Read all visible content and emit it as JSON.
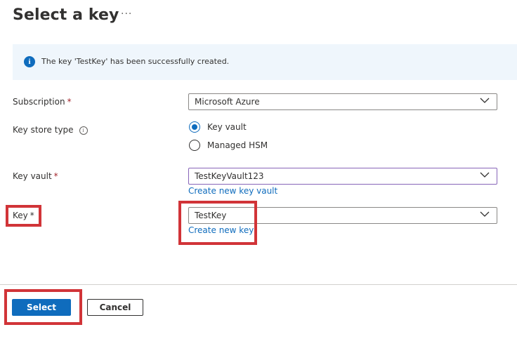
{
  "header": {
    "title": "Select a key",
    "more_label": "···"
  },
  "banner": {
    "icon": "info-icon",
    "message": "The key 'TestKey' has been successfully created."
  },
  "form": {
    "subscription": {
      "label": "Subscription",
      "required_mark": "*",
      "value": "Microsoft Azure"
    },
    "key_store_type": {
      "label": "Key store type",
      "info_icon": "info-icon",
      "options": [
        {
          "label": "Key vault",
          "selected": true
        },
        {
          "label": "Managed HSM",
          "selected": false
        }
      ]
    },
    "key_vault": {
      "label": "Key vault",
      "required_mark": "*",
      "value": "TestKeyVault123",
      "create_link": "Create new key vault"
    },
    "key": {
      "label": "Key",
      "required_mark": "*",
      "value": "TestKey",
      "create_link": "Create new key"
    }
  },
  "footer": {
    "select_label": "Select",
    "cancel_label": "Cancel"
  },
  "colors": {
    "accent": "#0f6cbd",
    "highlight": "#d13438",
    "banner_bg": "#eff6fc",
    "required": "#a4262c"
  }
}
